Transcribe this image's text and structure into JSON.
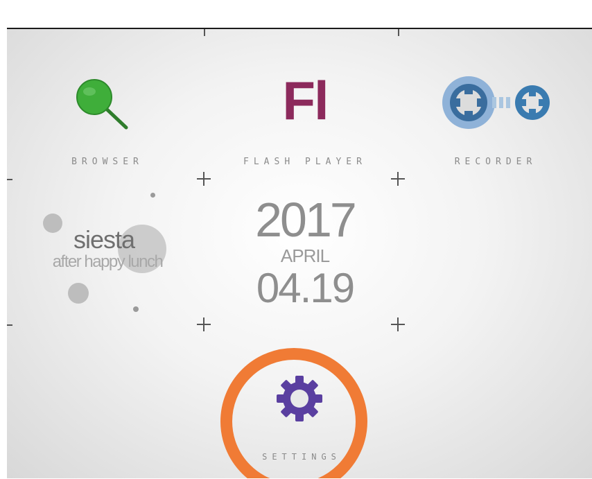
{
  "apps": {
    "browser": {
      "label": "BROWSER",
      "icon": "magnifier-icon"
    },
    "flash_player": {
      "label": "FLASH PLAYER",
      "logo_text": "Fl",
      "logo_color": "#8c2a5c"
    },
    "recorder": {
      "label": "RECORDER",
      "icon": "cassette-reels-icon"
    },
    "settings": {
      "label": "SETTINGS",
      "icon": "gear-icon",
      "ring_color": "#f07b35",
      "gear_color": "#5a3fa0"
    }
  },
  "clock": {
    "year": "2017",
    "month": "APRIL",
    "day": "04.19"
  },
  "wallpaper": {
    "title": "siesta",
    "subtitle": "after happy lunch"
  },
  "colors": {
    "browser_green": "#3fae3a",
    "recorder_blue": "#3a7bb0"
  }
}
